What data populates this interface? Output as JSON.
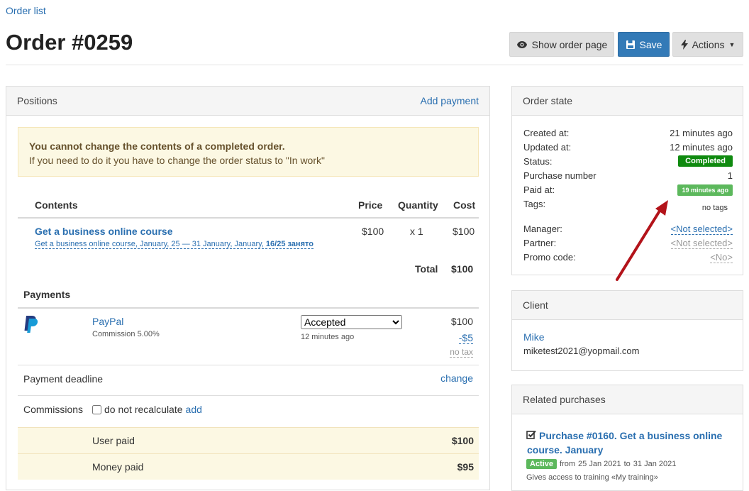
{
  "breadcrumb": "Order list",
  "title": "Order #0259",
  "buttons": {
    "show_order_page": "Show order page",
    "save": "Save",
    "actions": "Actions"
  },
  "positions": {
    "title": "Positions",
    "add_payment": "Add payment",
    "alert_title": "You cannot change the contents of a completed order.",
    "alert_text": "If you need to do it you have to change the order status to \"In work\"",
    "headers": {
      "contents": "Contents",
      "price": "Price",
      "quantity": "Quantity",
      "cost": "Cost"
    },
    "item": {
      "name": "Get a business online course",
      "sub_prefix": "Get a business online course, January, 25 — 31 January, January, ",
      "sub_bold": "16/25 занято",
      "price": "$100",
      "quantity": "x 1",
      "cost": "$100"
    },
    "total_label": "Total",
    "total_value": "$100"
  },
  "payments": {
    "title": "Payments",
    "method": "PayPal",
    "commission": "Commission 5.00%",
    "status_selected": "Accepted",
    "time": "12 minutes ago",
    "amount": "$100",
    "fee": "-$5",
    "tax": "no tax",
    "deadline_label": "Payment deadline",
    "deadline_action": "change",
    "commissions_label": "Commissions",
    "no_recalc": "do not recalculate",
    "add": "add",
    "user_paid_label": "User paid",
    "user_paid_value": "$100",
    "money_paid_label": "Money paid",
    "money_paid_value": "$95"
  },
  "order_state": {
    "title": "Order state",
    "created_label": "Created at:",
    "created_value": "21 minutes ago",
    "updated_label": "Updated at:",
    "updated_value": "12 minutes ago",
    "status_label": "Status:",
    "status_value": "Completed",
    "purchase_label": "Purchase number",
    "purchase_value": "1",
    "paid_label": "Paid at:",
    "paid_value": "19 minutes ago",
    "tags_label": "Tags:",
    "tags_value": "no tags",
    "manager_label": "Manager:",
    "manager_value": "<Not selected>",
    "partner_label": "Partner:",
    "partner_value": "<Not selected>",
    "promo_label": "Promo code:",
    "promo_value": "<No>"
  },
  "client": {
    "title": "Client",
    "name": "Mike",
    "email": "miketest2021@yopmail.com"
  },
  "related": {
    "title": "Related purchases",
    "purchase_title": "Purchase #0160. Get a business online course. January",
    "badge": "Active",
    "from_label": "from",
    "from_date": "25 Jan 2021",
    "to_label": "to",
    "to_date": "31 Jan 2021",
    "access": "Gives access to training «My training»"
  },
  "colors": {
    "primary": "#337ab7",
    "link": "#2a6fb0",
    "completed": "#0f8a0f",
    "paid_badge": "#5cb85c",
    "active_badge": "#5cb85c",
    "alert_bg": "#fcf8e3",
    "arrow": "#b3131a"
  }
}
